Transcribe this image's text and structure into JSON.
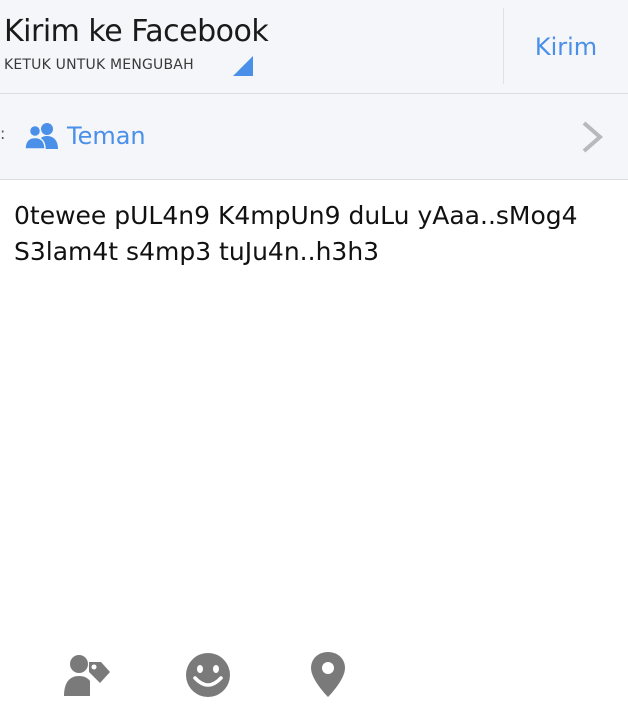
{
  "header": {
    "title": "Kirim ke Facebook",
    "subtitle": "KETUK UNTUK MENGUBAH",
    "send_label": "Kirim"
  },
  "audience": {
    "prefix": ":",
    "label": "Teman",
    "icon": "friends-icon"
  },
  "message": {
    "text": "0tewee pUL4n9 K4mpUn9 duLu yAaa..sMog4 S3lam4t s4mp3 tuJu4n..h3h3"
  },
  "toolbar": {
    "icons": [
      "tag-people-icon",
      "emoji-icon",
      "location-icon"
    ]
  },
  "colors": {
    "accent": "#4a8fe8",
    "header_bg": "#f5f6fa",
    "icon_gray": "#7a7a7a"
  }
}
